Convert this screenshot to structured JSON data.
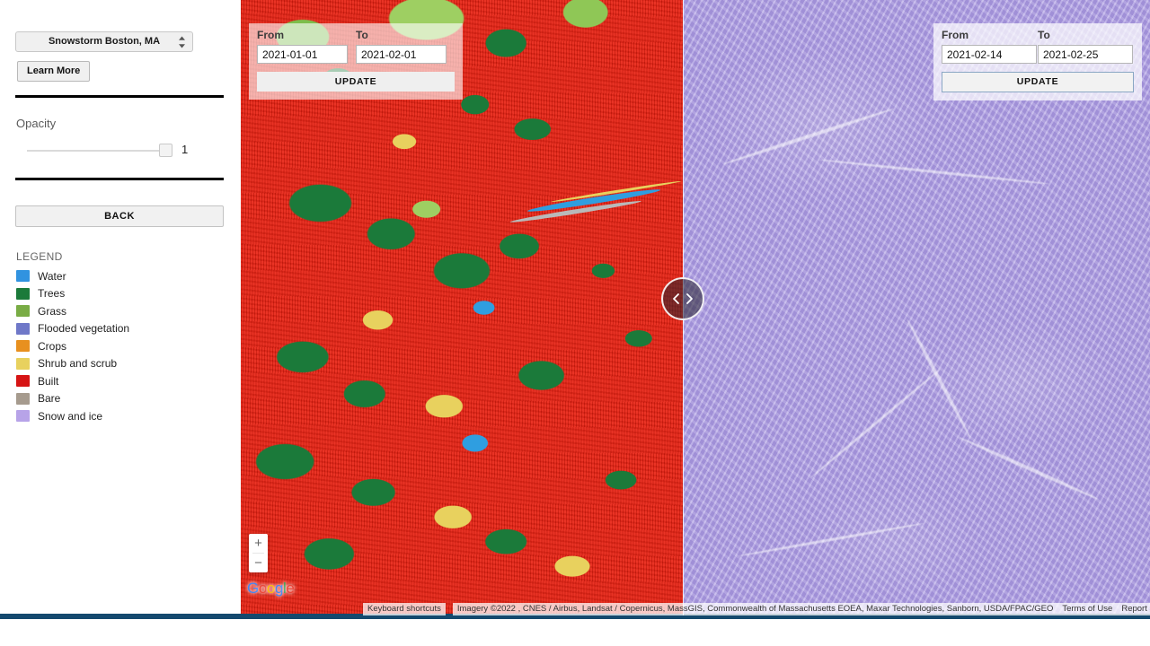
{
  "sidebar": {
    "dataset_select": {
      "value": "Snowstorm Boston, MA",
      "icon": "spinner-arrows-icon"
    },
    "learn_more_label": "Learn More",
    "opacity": {
      "label": "Opacity",
      "value": "1"
    },
    "back_label": "BACK",
    "legend": {
      "title": "LEGEND",
      "items": [
        {
          "label": "Water",
          "color": "#3193e0"
        },
        {
          "label": "Trees",
          "color": "#1b7a3a"
        },
        {
          "label": "Grass",
          "color": "#79ac45"
        },
        {
          "label": "Flooded vegetation",
          "color": "#6f78c8"
        },
        {
          "label": "Crops",
          "color": "#e8901f"
        },
        {
          "label": "Shrub and scrub",
          "color": "#e8d15e"
        },
        {
          "label": "Built",
          "color": "#d61414"
        },
        {
          "label": "Bare",
          "color": "#a69b8e"
        },
        {
          "label": "Snow and ice",
          "color": "#b7a3e8"
        }
      ]
    }
  },
  "map": {
    "left_panel": {
      "from_label": "From",
      "to_label": "To",
      "from_value": "2021-01-01",
      "to_value": "2021-02-01",
      "update_label": "UPDATE"
    },
    "right_panel": {
      "from_label": "From",
      "to_label": "To",
      "from_value": "2021-02-14",
      "to_value": "2021-02-25",
      "update_label": "UPDATE"
    },
    "swipe_handle_icon": "swipe-left-right-arrows-icon",
    "zoom_in_label": "+",
    "zoom_out_label": "−",
    "brand": {
      "g": "G",
      "o1": "o",
      "o2": "o",
      "g2": "g",
      "l": "l",
      "e": "e"
    },
    "attribution": {
      "keyboard_shortcuts": "Keyboard shortcuts",
      "imagery": "Imagery ©2022 , CNES / Airbus, Landsat / Copernicus, MassGIS, Commonwealth of Massachusetts EOEA, Maxar Technologies, Sanborn, USDA/FPAC/GEO",
      "terms": "Terms of Use",
      "report": "Report a map error"
    }
  },
  "colors": {
    "built_red": "#e81f10",
    "snow_lavender": "#ae9ee4",
    "bottom_bar": "#14496e",
    "google_blue": "#4285F4",
    "google_red": "#EA4335",
    "google_yellow": "#FBBC05",
    "google_green": "#34A853"
  }
}
